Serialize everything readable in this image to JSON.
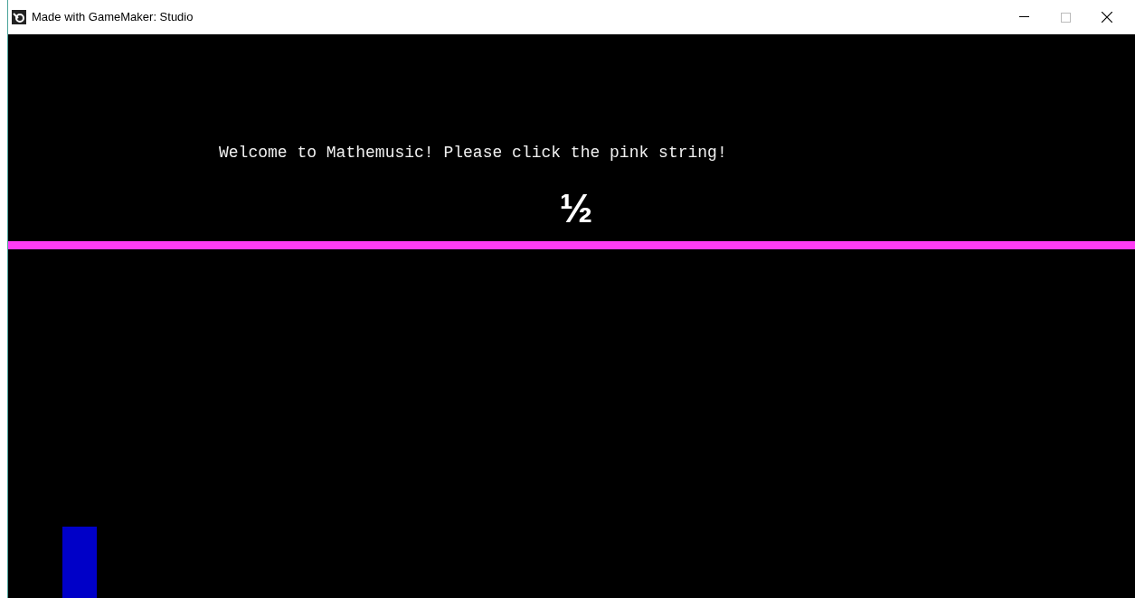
{
  "window": {
    "title": "Made with GameMaker: Studio"
  },
  "game": {
    "message": "Welcome to Mathemusic! Please click the pink string!",
    "fraction": "½"
  }
}
